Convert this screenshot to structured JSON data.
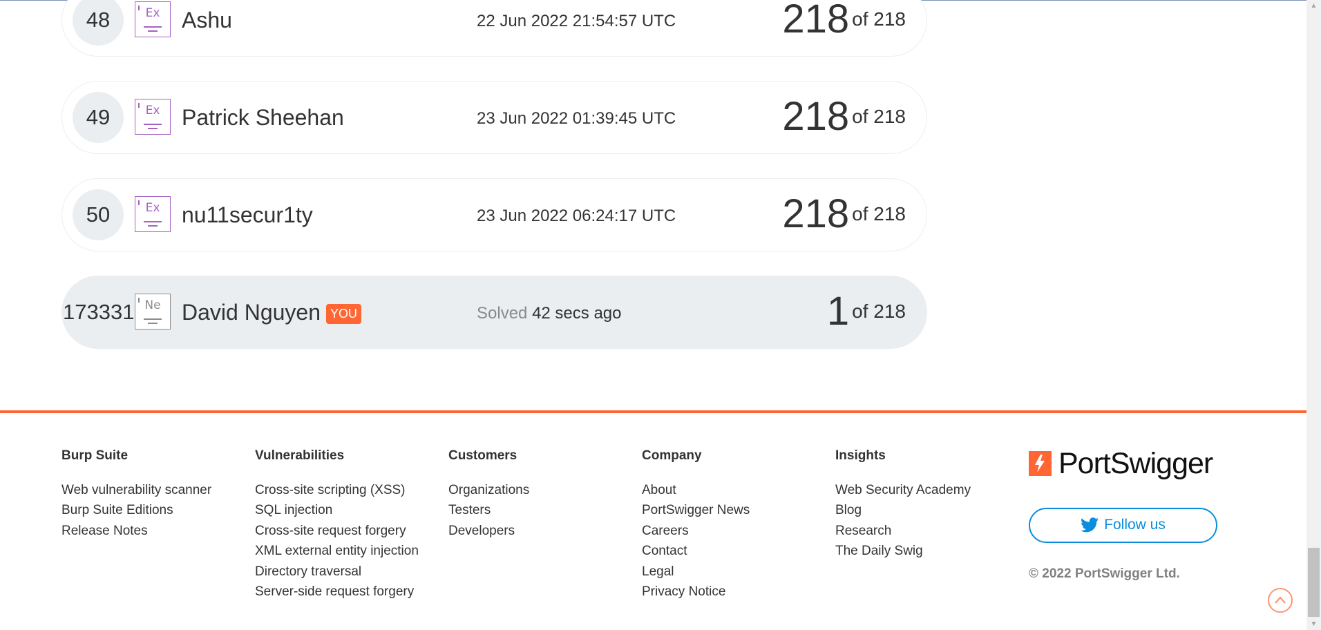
{
  "leaderboard": {
    "rows": [
      {
        "rank": "48",
        "avatar_abbr": "Ex",
        "name": "Ashu",
        "date": "22 Jun 2022 21:54:57 UTC",
        "score": "218",
        "of_total": "of 218"
      },
      {
        "rank": "49",
        "avatar_abbr": "Ex",
        "name": "Patrick Sheehan",
        "date": "23 Jun 2022 01:39:45 UTC",
        "score": "218",
        "of_total": "of 218"
      },
      {
        "rank": "50",
        "avatar_abbr": "Ex",
        "name": "nu11secur1ty",
        "date": "23 Jun 2022 06:24:17 UTC",
        "score": "218",
        "of_total": "of 218"
      }
    ],
    "current_user": {
      "rank": "173331",
      "avatar_abbr": "Ne",
      "name": "David Nguyen",
      "badge": "YOU",
      "solved_label": "Solved",
      "solved_time": "42 secs ago",
      "score": "1",
      "of_total": "of 218"
    }
  },
  "footer": {
    "columns": [
      {
        "heading": "Burp Suite",
        "links": [
          "Web vulnerability scanner",
          "Burp Suite Editions",
          "Release Notes"
        ]
      },
      {
        "heading": "Vulnerabilities",
        "links": [
          "Cross-site scripting (XSS)",
          "SQL injection",
          "Cross-site request forgery",
          "XML external entity injection",
          "Directory traversal",
          "Server-side request forgery"
        ]
      },
      {
        "heading": "Customers",
        "links": [
          "Organizations",
          "Testers",
          "Developers"
        ]
      },
      {
        "heading": "Company",
        "links": [
          "About",
          "PortSwigger News",
          "Careers",
          "Contact",
          "Legal",
          "Privacy Notice"
        ]
      },
      {
        "heading": "Insights",
        "links": [
          "Web Security Academy",
          "Blog",
          "Research",
          "The Daily Swig"
        ]
      }
    ],
    "brand": "PortSwigger",
    "follow_label": "Follow us",
    "copyright": "© 2022 PortSwigger Ltd."
  },
  "icons": {
    "avatar": "user-level-avatar-icon",
    "brand_logo": "portswigger-logo-icon",
    "twitter": "twitter-bird-icon",
    "scroll_top": "chevron-up-circle-icon"
  },
  "colors": {
    "accent": "#ff6633",
    "twitter_blue": "#0a8ddc",
    "avatar_purple": "#a661c2",
    "highlight_row": "#eaeef1"
  }
}
